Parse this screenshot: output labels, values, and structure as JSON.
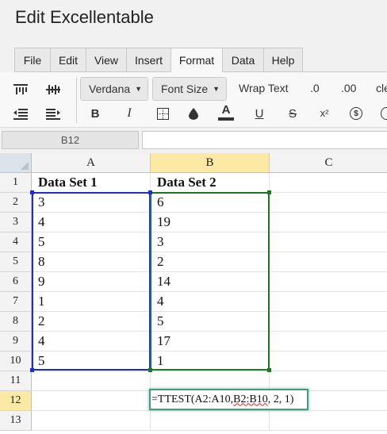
{
  "window": {
    "title": "Edit Excellentable"
  },
  "menu": {
    "tabs": [
      "File",
      "Edit",
      "View",
      "Insert",
      "Format",
      "Data",
      "Help"
    ],
    "active": "Format"
  },
  "toolbar": {
    "font_family": "Verdana",
    "font_size": "Font Size",
    "wrap_text": "Wrap Text",
    "decrease_decimal": ".0",
    "increase_decimal": ".00",
    "clear_partial": "cle",
    "bold": "B",
    "italic": "I",
    "text_color": "A",
    "underline": "U",
    "strikethrough": "S",
    "superscript": "x²",
    "currency": "$"
  },
  "formula_bar": {
    "cell_ref": "B12",
    "value": ""
  },
  "sheet": {
    "columns": [
      "A",
      "B",
      "C"
    ],
    "selected_column": "B",
    "rows": [
      "1",
      "2",
      "3",
      "4",
      "5",
      "6",
      "7",
      "8",
      "9",
      "10",
      "11",
      "12",
      "13"
    ],
    "selected_row": "12",
    "cells": {
      "A": [
        "Data Set 1",
        "3",
        "4",
        "5",
        "8",
        "9",
        "1",
        "2",
        "4",
        "5",
        "",
        "",
        ""
      ],
      "B": [
        "Data Set 2",
        "6",
        "19",
        "3",
        "2",
        "14",
        "4",
        "5",
        "17",
        "1",
        "",
        "",
        ""
      ],
      "C": [
        "",
        "",
        "",
        "",
        "",
        "",
        "",
        "",
        "",
        "",
        "",
        "",
        ""
      ]
    },
    "editing": {
      "cell": "B12",
      "prefix": "=TTEST(A2:A10, ",
      "underlined": "B2:B10",
      "suffix": ", 2, 1)"
    }
  },
  "colors": {
    "range_a": "#1d2fc4",
    "range_b": "#1b7a1b",
    "selected_header": "#fde9a6",
    "editor_border": "#3aa27a"
  }
}
